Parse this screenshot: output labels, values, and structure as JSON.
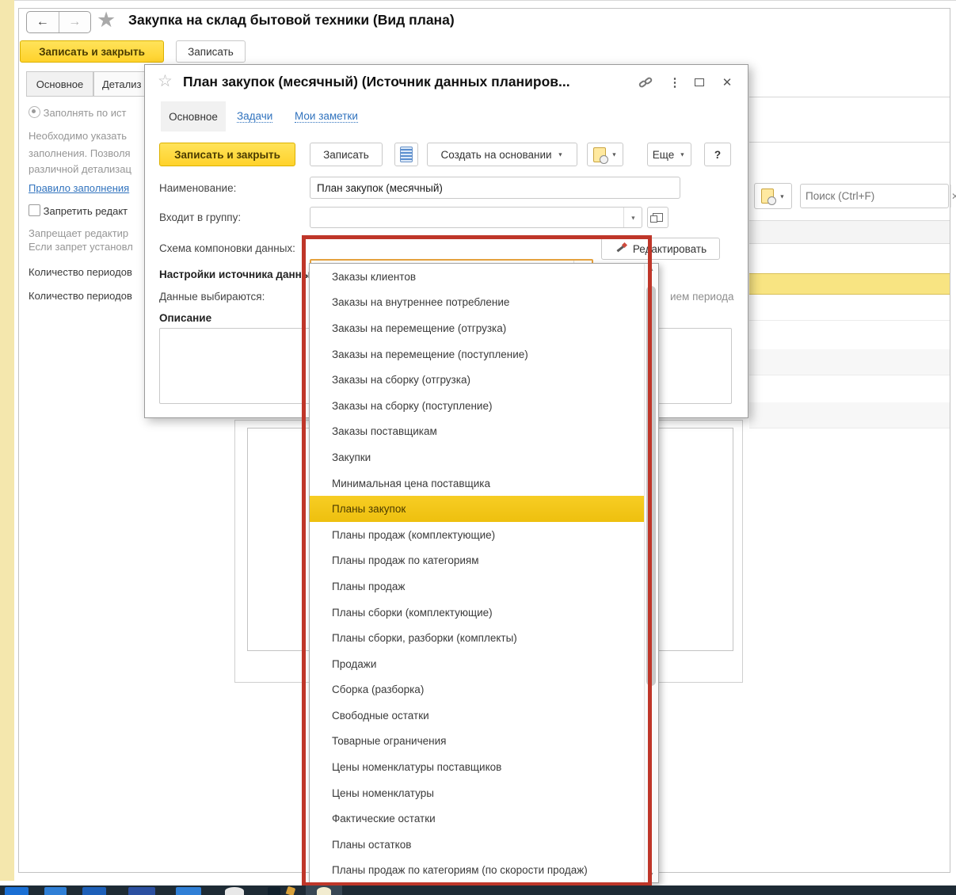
{
  "colors": {
    "accent_yellow": "#FFD42A",
    "selected_row_yellow": "#F3C71C",
    "table_row_yellow": "#F8E482",
    "annotation_red": "#BF3629",
    "link_blue": "#3173BE",
    "selection_blue": "#3E6ED8",
    "taskbar_dark": "#1E2B35",
    "left_strip_yellow": "#F4E7AD"
  },
  "main_window": {
    "title": "Закупка на склад бытовой техники (Вид плана)",
    "toolbar": {
      "save_close": "Записать и закрыть",
      "save": "Записать"
    },
    "tabs": {
      "main": "Основное",
      "detail": "Детализ"
    },
    "left_pane": {
      "radio_label": "Заполнять по ист",
      "hint1": "Необходимо указать",
      "hint2": "заполнения. Позволя",
      "hint3": "различной детализац",
      "rule_link": "Правило заполнения",
      "checkbox_label": "Запретить редакт",
      "hint4": "Запрещает редактир",
      "hint5": "Если запрет установл",
      "periods1": "Количество периодов",
      "periods2": "Количество периодов"
    },
    "right_pane": {
      "search_placeholder": "Поиск (Ctrl+F)"
    }
  },
  "dialog": {
    "title": "План закупок (месячный) (Источник данных планиров...",
    "tabs": {
      "main": "Основное",
      "tasks": "Задачи",
      "notes": "Мои заметки"
    },
    "toolbar": {
      "save_close": "Записать и закрыть",
      "save": "Записать",
      "create_from": "Создать на основании",
      "more": "Еще",
      "help": "?"
    },
    "fields": {
      "name_label": "Наименование:",
      "name_value": "План закупок (месячный)",
      "group_label": "Входит в группу:",
      "group_value": "",
      "schema_label": "Схема компоновки данных:",
      "schema_value": "Планы закупок",
      "edit_button": "Редактировать",
      "settings_heading": "Настройки источника данных",
      "data_select_label": "Данные выбираются:",
      "period_fragment": "ием периода",
      "description_heading": "Описание"
    }
  },
  "dropdown": {
    "selected_index": 9,
    "items": [
      "Заказы клиентов",
      "Заказы на внутреннее потребление",
      "Заказы на перемещение (отгрузка)",
      "Заказы на перемещение (поступление)",
      "Заказы на сборку (отгрузка)",
      "Заказы на сборку (поступление)",
      "Заказы поставщикам",
      "Закупки",
      "Минимальная цена поставщика",
      "Планы закупок",
      "Планы продаж (комплектующие)",
      "Планы продаж по категориям",
      "Планы продаж",
      "Планы сборки (комплектующие)",
      "Планы сборки, разборки (комплекты)",
      "Продажи",
      "Сборка (разборка)",
      "Свободные остатки",
      "Товарные ограничения",
      "Цены номенклатуры поставщиков",
      "Цены номенклатуры",
      "Фактические остатки",
      "Планы остатков",
      "Планы продаж по категориям (по скорости продаж)"
    ]
  }
}
